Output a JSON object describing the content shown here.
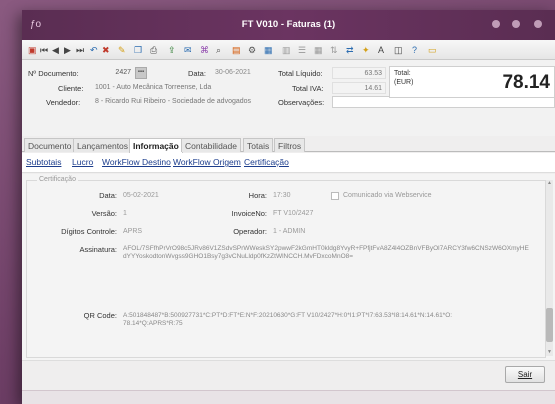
{
  "window": {
    "title": "FT V010 - Faturas (1)"
  },
  "header": {
    "documento_label": "Nº Documento:",
    "documento_value": "2427",
    "data_label": "Data:",
    "data_value": "30-06-2021",
    "cliente_label": "Cliente:",
    "cliente_value": "1001 - Auto Mecânica Torreense, Lda",
    "vendedor_label": "Vendedor:",
    "vendedor_value": "8 - Ricardo Rui Ribeiro - Sociedade de advogados",
    "total_liquido_label": "Total Líquido:",
    "total_liquido_value": "63.53",
    "total_iva_label": "Total IVA:",
    "total_iva_value": "14.61",
    "observacoes_label": "Observações:",
    "total_label": "Total:",
    "total_currency": "(EUR)",
    "total_value": "78.14"
  },
  "tabs": [
    "Documento",
    "Lançamentos",
    "Informação",
    "Contabilidade",
    "Totais",
    "Filtros"
  ],
  "subtabs": [
    "Subtotais",
    "Lucro",
    "WorkFlow Destino",
    "WorkFlow Origem",
    "Certificação"
  ],
  "cert": {
    "group_title": "Certificação",
    "data_label": "Data:",
    "data_value": "05-02-2021",
    "hora_label": "Hora:",
    "hora_value": "17:30",
    "comunicado_label": "Comunicado via Webservice",
    "versao_label": "Versão:",
    "versao_value": "1",
    "invoiceno_label": "InvoiceNo:",
    "invoiceno_value": "FT V10/2427",
    "digitos_label": "Dígitos Controle:",
    "digitos_value": "APRS",
    "operador_label": "Operador:",
    "operador_value": "1 - ADMIN",
    "assinatura_label": "Assinatura:",
    "assinatura_value": "AFOL/7SFfhPrVrO98c5JRv86V1ZSdvSPrWWeskSY2pwwF2kGmHT0kldg8YvyR+FPfjtFvA8Z4l4OZBnVFByOl7ARCY3fw6CNSzW6OXmyHEdYYYoskodtonWvgss9GHO1Bsy7g3vCNuLldp0fKzZtWlNCCH.MvFDxcoMnO8=",
    "qr_label": "QR Code:",
    "qr_value": "A:501848487*B:500927731*C:PT*D:FT*E:N*F:20210630*G:FT V10/2427*H:0*I1:PT*I7:63.53*I8:14.61*N:14.61*O:78.14*Q:APRS*R:75"
  },
  "footer": {
    "sair_label": "Sair"
  },
  "colors": {
    "titlebar": "#5a2d52",
    "link": "#1c3d8c",
    "background": "#7a4a6e"
  }
}
